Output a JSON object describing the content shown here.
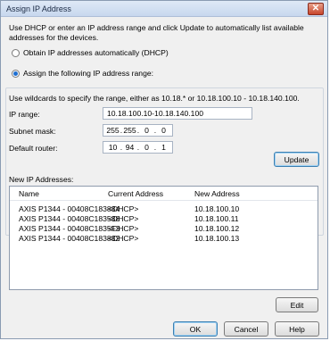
{
  "window": {
    "title": "Assign IP Address",
    "close_glyph": "✕"
  },
  "intro": "Use DHCP or enter an IP address range and click Update to automatically list available addresses for the devices.",
  "radios": {
    "dhcp": "Obtain IP addresses automatically (DHCP)",
    "assign": "Assign the following IP address range:"
  },
  "hint": "Use wildcards to specify the range, either as 10.18.* or 10.18.100.10 - 10.18.140.100.",
  "fields": {
    "ip_range_label": "IP range:",
    "ip_range_value": "10.18.100.10-10.18.140.100",
    "subnet_label": "Subnet mask:",
    "subnet": [
      "255",
      "255",
      "0",
      "0"
    ],
    "router_label": "Default router:",
    "router": [
      "10",
      "94",
      "0",
      "1"
    ]
  },
  "buttons": {
    "update": "Update",
    "edit": "Edit",
    "ok": "OK",
    "cancel": "Cancel",
    "help": "Help"
  },
  "list": {
    "label": "New IP Addresses:",
    "columns": [
      "Name",
      "Current Address",
      "New Address"
    ],
    "rows": [
      [
        "AXIS P1344 - 00408C183884",
        "<DHCP>",
        "10.18.100.10"
      ],
      [
        "AXIS P1344 - 00408C183588",
        "<DHCP>",
        "10.18.100.11"
      ],
      [
        "AXIS P1344 - 00408C1835F3",
        "<DHCP>",
        "10.18.100.12"
      ],
      [
        "AXIS P1344 - 00408C183882",
        "<DHCP>",
        "10.18.100.13"
      ]
    ]
  }
}
